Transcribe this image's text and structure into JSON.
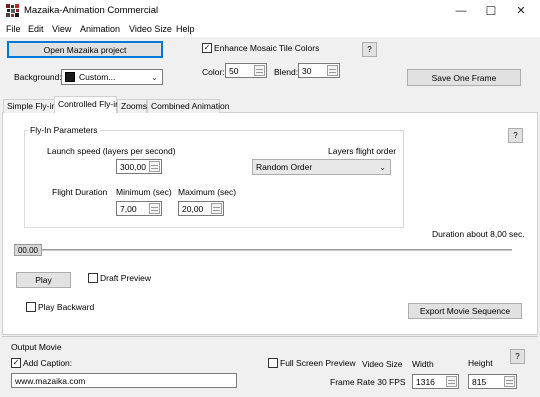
{
  "window": {
    "title": "Mazaika-Animation Commercial",
    "minimize": "—",
    "maximize": "☐",
    "close": "✕"
  },
  "menu": [
    "File",
    "Edit",
    "View",
    "Animation",
    "Video Size",
    "Help"
  ],
  "top": {
    "open_project": "Open Mazaika project",
    "background_label": "Background:",
    "background_value": "Custom...",
    "enhance_label": "Enhance Mosaic Tile Colors",
    "enhance_checked": "✓",
    "help": "?",
    "color_label": "Color:",
    "color_value": "50",
    "blend_label": "Blend:",
    "blend_value": "30",
    "save_frame": "Save One Frame"
  },
  "tabs": [
    "Simple Fly-in",
    "Controlled Fly-in",
    "Zooms",
    "Combined Animation"
  ],
  "flyin": {
    "group_title": "Fly-In Parameters",
    "launch_label": "Launch speed (layers per second)",
    "launch_value": "300,00",
    "order_label": "Layers flight order",
    "order_value": "Random Order",
    "duration_label": "Flight Duration",
    "min_label": "Minimum (sec)",
    "min_value": "7,00",
    "max_label": "Maximum (sec)",
    "max_value": "20,00",
    "help": "?"
  },
  "timeline": {
    "duration_text": "Duration about 8,00 sec.",
    "position": "00.00",
    "play": "Play",
    "draft_label": "Draft Preview",
    "backward_label": "Play Backward",
    "export": "Export Movie Sequence"
  },
  "output": {
    "section_label": "Output Movie",
    "caption_label": "Add Caption:",
    "caption_checked": "✓",
    "caption_value": "www.mazaika.com",
    "fullscreen_label": "Full Screen Preview",
    "video_size_label": "Video Size",
    "width_label": "Width",
    "width_value": "1316",
    "height_label": "Height",
    "height_value": "815",
    "frame_rate": "Frame Rate 30 FPS",
    "help": "?"
  },
  "icons": {
    "app": "app-icon",
    "dropdown": "chevron-down-icon",
    "checkmark": "checkmark-icon"
  }
}
